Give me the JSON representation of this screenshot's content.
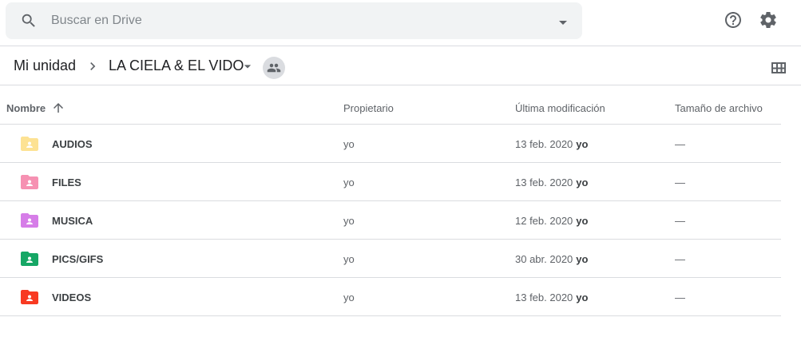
{
  "search": {
    "placeholder": "Buscar en Drive",
    "search_icon": "search-icon",
    "options_icon": "arrow-drop-down-icon"
  },
  "top_actions": [
    {
      "icon": "help-icon"
    },
    {
      "icon": "settings-gear-icon"
    }
  ],
  "breadcrumb": {
    "root": "Mi unidad",
    "current": "LA CIELA & EL VIDO",
    "separator_icon": "chevron-right-icon",
    "menu_icon": "arrow-drop-down-icon",
    "shared_icon": "people-icon",
    "view_toggle_icon": "grid-view-icon"
  },
  "table": {
    "columns": {
      "name": "Nombre",
      "owner": "Propietario",
      "modified": "Última modificación",
      "size": "Tamaño de archivo"
    },
    "sort": {
      "column": "name",
      "direction": "ascending",
      "icon": "arrow-upward-icon"
    },
    "rows": [
      {
        "name": "AUDIOS",
        "owner": "yo",
        "modified_date": "13 feb. 2020",
        "modified_by": "yo",
        "size": "—",
        "color": "#fde293"
      },
      {
        "name": "FILES",
        "owner": "yo",
        "modified_date": "13 feb. 2020",
        "modified_by": "yo",
        "size": "—",
        "color": "#f691b2"
      },
      {
        "name": "MUSICA",
        "owner": "yo",
        "modified_date": "12 feb. 2020",
        "modified_by": "yo",
        "size": "—",
        "color": "#d67de8"
      },
      {
        "name": "PICS/GIFS",
        "owner": "yo",
        "modified_date": "30 abr. 2020",
        "modified_by": "yo",
        "size": "—",
        "color": "#16a765"
      },
      {
        "name": "VIDEOS",
        "owner": "yo",
        "modified_date": "13 feb. 2020",
        "modified_by": "yo",
        "size": "—",
        "color": "#f83a22"
      }
    ]
  }
}
